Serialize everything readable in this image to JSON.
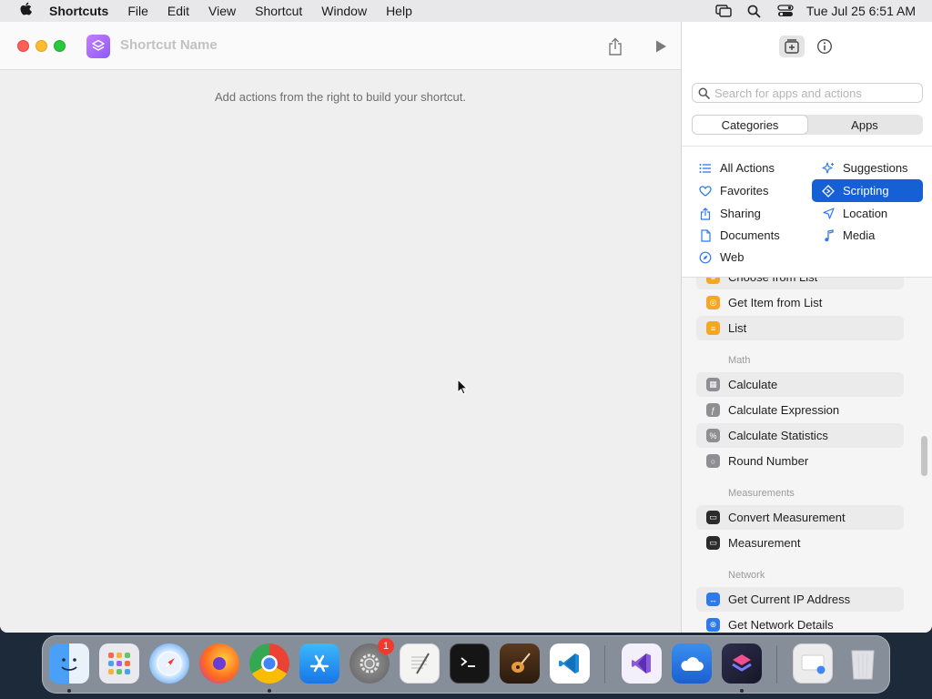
{
  "menubar": {
    "app_name": "Shortcuts",
    "items": [
      "File",
      "Edit",
      "View",
      "Shortcut",
      "Window",
      "Help"
    ],
    "clock": "Tue Jul 25  6:51 AM"
  },
  "window": {
    "shortcut_name_placeholder": "Shortcut Name",
    "hint": "Add actions from the right to build your shortcut."
  },
  "sidebar": {
    "search_placeholder": "Search for apps and actions",
    "segments": [
      "Categories",
      "Apps"
    ],
    "selected_segment": "Categories",
    "categories": [
      {
        "label": "All Actions",
        "icon": "list-icon"
      },
      {
        "label": "Suggestions",
        "icon": "sparkle-icon"
      },
      {
        "label": "Favorites",
        "icon": "heart-icon"
      },
      {
        "label": "Scripting",
        "icon": "scripting-icon",
        "selected": true
      },
      {
        "label": "Sharing",
        "icon": "share-icon"
      },
      {
        "label": "Location",
        "icon": "location-arrow-icon"
      },
      {
        "label": "Documents",
        "icon": "document-icon"
      },
      {
        "label": "Media",
        "icon": "music-note-icon"
      },
      {
        "label": "Web",
        "icon": "compass-icon"
      }
    ],
    "actions": [
      {
        "label": "Choose from List",
        "color": "#f5a623"
      },
      {
        "label": "Get Item from List",
        "color": "#f5a623"
      },
      {
        "label": "List",
        "color": "#f5a623"
      },
      {
        "label": "Calculate",
        "color": "#8e8e93"
      },
      {
        "label": "Calculate Expression",
        "color": "#8e8e93"
      },
      {
        "label": "Calculate Statistics",
        "color": "#8e8e93"
      },
      {
        "label": "Round Number",
        "color": "#8e8e93"
      },
      {
        "label": "Convert Measurement",
        "color": "#2b2b2b"
      },
      {
        "label": "Measurement",
        "color": "#2b2b2b"
      },
      {
        "label": "Get Current IP Address",
        "color": "#2f79ee"
      },
      {
        "label": "Get Network Details",
        "color": "#2f79ee"
      }
    ],
    "sections": {
      "math": "Math",
      "measurements": "Measurements",
      "network": "Network"
    }
  },
  "dock": {
    "apps": [
      "Finder",
      "Launchpad",
      "Safari",
      "Firefox",
      "Chrome",
      "App Store",
      "System Settings",
      "TextEdit",
      "Terminal",
      "GarageBand",
      "VS Code",
      "Visual Studio",
      "iCloud",
      "Shortcuts",
      "Downloads",
      "Trash"
    ],
    "settings_badge": "1"
  }
}
